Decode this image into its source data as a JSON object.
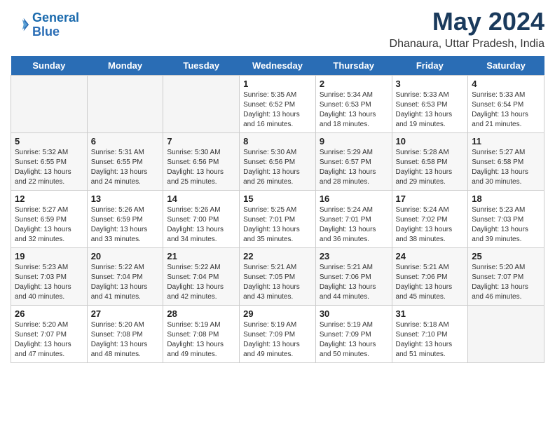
{
  "header": {
    "logo_line1": "General",
    "logo_line2": "Blue",
    "title": "May 2024",
    "subtitle": "Dhanaura, Uttar Pradesh, India"
  },
  "days_of_week": [
    "Sunday",
    "Monday",
    "Tuesday",
    "Wednesday",
    "Thursday",
    "Friday",
    "Saturday"
  ],
  "weeks": [
    [
      {
        "day": "",
        "info": ""
      },
      {
        "day": "",
        "info": ""
      },
      {
        "day": "",
        "info": ""
      },
      {
        "day": "1",
        "info": "Sunrise: 5:35 AM\nSunset: 6:52 PM\nDaylight: 13 hours\nand 16 minutes."
      },
      {
        "day": "2",
        "info": "Sunrise: 5:34 AM\nSunset: 6:53 PM\nDaylight: 13 hours\nand 18 minutes."
      },
      {
        "day": "3",
        "info": "Sunrise: 5:33 AM\nSunset: 6:53 PM\nDaylight: 13 hours\nand 19 minutes."
      },
      {
        "day": "4",
        "info": "Sunrise: 5:33 AM\nSunset: 6:54 PM\nDaylight: 13 hours\nand 21 minutes."
      }
    ],
    [
      {
        "day": "5",
        "info": "Sunrise: 5:32 AM\nSunset: 6:55 PM\nDaylight: 13 hours\nand 22 minutes."
      },
      {
        "day": "6",
        "info": "Sunrise: 5:31 AM\nSunset: 6:55 PM\nDaylight: 13 hours\nand 24 minutes."
      },
      {
        "day": "7",
        "info": "Sunrise: 5:30 AM\nSunset: 6:56 PM\nDaylight: 13 hours\nand 25 minutes."
      },
      {
        "day": "8",
        "info": "Sunrise: 5:30 AM\nSunset: 6:56 PM\nDaylight: 13 hours\nand 26 minutes."
      },
      {
        "day": "9",
        "info": "Sunrise: 5:29 AM\nSunset: 6:57 PM\nDaylight: 13 hours\nand 28 minutes."
      },
      {
        "day": "10",
        "info": "Sunrise: 5:28 AM\nSunset: 6:58 PM\nDaylight: 13 hours\nand 29 minutes."
      },
      {
        "day": "11",
        "info": "Sunrise: 5:27 AM\nSunset: 6:58 PM\nDaylight: 13 hours\nand 30 minutes."
      }
    ],
    [
      {
        "day": "12",
        "info": "Sunrise: 5:27 AM\nSunset: 6:59 PM\nDaylight: 13 hours\nand 32 minutes."
      },
      {
        "day": "13",
        "info": "Sunrise: 5:26 AM\nSunset: 6:59 PM\nDaylight: 13 hours\nand 33 minutes."
      },
      {
        "day": "14",
        "info": "Sunrise: 5:26 AM\nSunset: 7:00 PM\nDaylight: 13 hours\nand 34 minutes."
      },
      {
        "day": "15",
        "info": "Sunrise: 5:25 AM\nSunset: 7:01 PM\nDaylight: 13 hours\nand 35 minutes."
      },
      {
        "day": "16",
        "info": "Sunrise: 5:24 AM\nSunset: 7:01 PM\nDaylight: 13 hours\nand 36 minutes."
      },
      {
        "day": "17",
        "info": "Sunrise: 5:24 AM\nSunset: 7:02 PM\nDaylight: 13 hours\nand 38 minutes."
      },
      {
        "day": "18",
        "info": "Sunrise: 5:23 AM\nSunset: 7:03 PM\nDaylight: 13 hours\nand 39 minutes."
      }
    ],
    [
      {
        "day": "19",
        "info": "Sunrise: 5:23 AM\nSunset: 7:03 PM\nDaylight: 13 hours\nand 40 minutes."
      },
      {
        "day": "20",
        "info": "Sunrise: 5:22 AM\nSunset: 7:04 PM\nDaylight: 13 hours\nand 41 minutes."
      },
      {
        "day": "21",
        "info": "Sunrise: 5:22 AM\nSunset: 7:04 PM\nDaylight: 13 hours\nand 42 minutes."
      },
      {
        "day": "22",
        "info": "Sunrise: 5:21 AM\nSunset: 7:05 PM\nDaylight: 13 hours\nand 43 minutes."
      },
      {
        "day": "23",
        "info": "Sunrise: 5:21 AM\nSunset: 7:06 PM\nDaylight: 13 hours\nand 44 minutes."
      },
      {
        "day": "24",
        "info": "Sunrise: 5:21 AM\nSunset: 7:06 PM\nDaylight: 13 hours\nand 45 minutes."
      },
      {
        "day": "25",
        "info": "Sunrise: 5:20 AM\nSunset: 7:07 PM\nDaylight: 13 hours\nand 46 minutes."
      }
    ],
    [
      {
        "day": "26",
        "info": "Sunrise: 5:20 AM\nSunset: 7:07 PM\nDaylight: 13 hours\nand 47 minutes."
      },
      {
        "day": "27",
        "info": "Sunrise: 5:20 AM\nSunset: 7:08 PM\nDaylight: 13 hours\nand 48 minutes."
      },
      {
        "day": "28",
        "info": "Sunrise: 5:19 AM\nSunset: 7:08 PM\nDaylight: 13 hours\nand 49 minutes."
      },
      {
        "day": "29",
        "info": "Sunrise: 5:19 AM\nSunset: 7:09 PM\nDaylight: 13 hours\nand 49 minutes."
      },
      {
        "day": "30",
        "info": "Sunrise: 5:19 AM\nSunset: 7:09 PM\nDaylight: 13 hours\nand 50 minutes."
      },
      {
        "day": "31",
        "info": "Sunrise: 5:18 AM\nSunset: 7:10 PM\nDaylight: 13 hours\nand 51 minutes."
      },
      {
        "day": "",
        "info": ""
      }
    ]
  ]
}
